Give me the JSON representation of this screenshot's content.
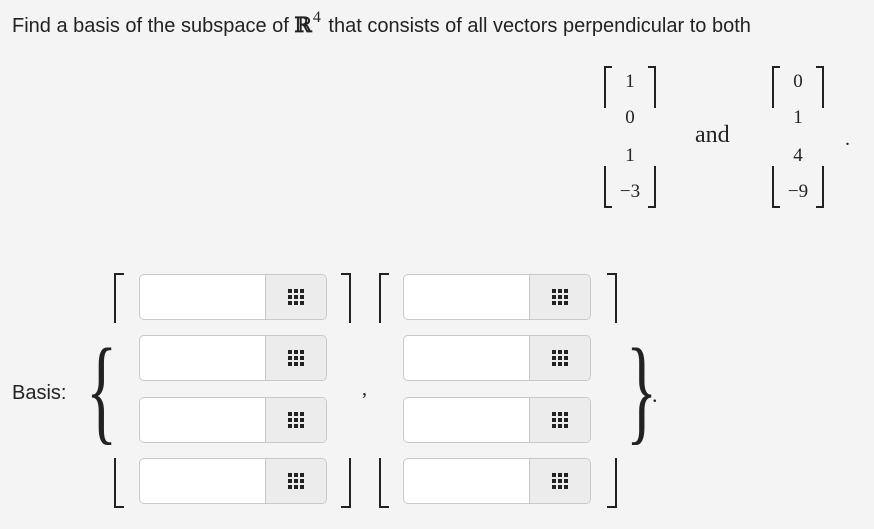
{
  "question": {
    "prefix": "Find a basis of the subspace of ",
    "space_symbol": "ℝ",
    "space_dim": "4",
    "suffix": " that consists of all vectors perpendicular to both"
  },
  "given_vectors": [
    {
      "entries": [
        "1",
        "0",
        "1",
        "−3"
      ]
    },
    {
      "entries": [
        "0",
        "1",
        "4",
        "−9"
      ]
    }
  ],
  "connector_word": "and",
  "end_punctuation": ".",
  "answer": {
    "label": "Basis:",
    "separator": ",",
    "end_punctuation": ".",
    "vectors": [
      {
        "fields": [
          "",
          "",
          "",
          ""
        ]
      },
      {
        "fields": [
          "",
          "",
          "",
          ""
        ]
      }
    ],
    "keypad_icon": "keypad-grid-icon"
  }
}
